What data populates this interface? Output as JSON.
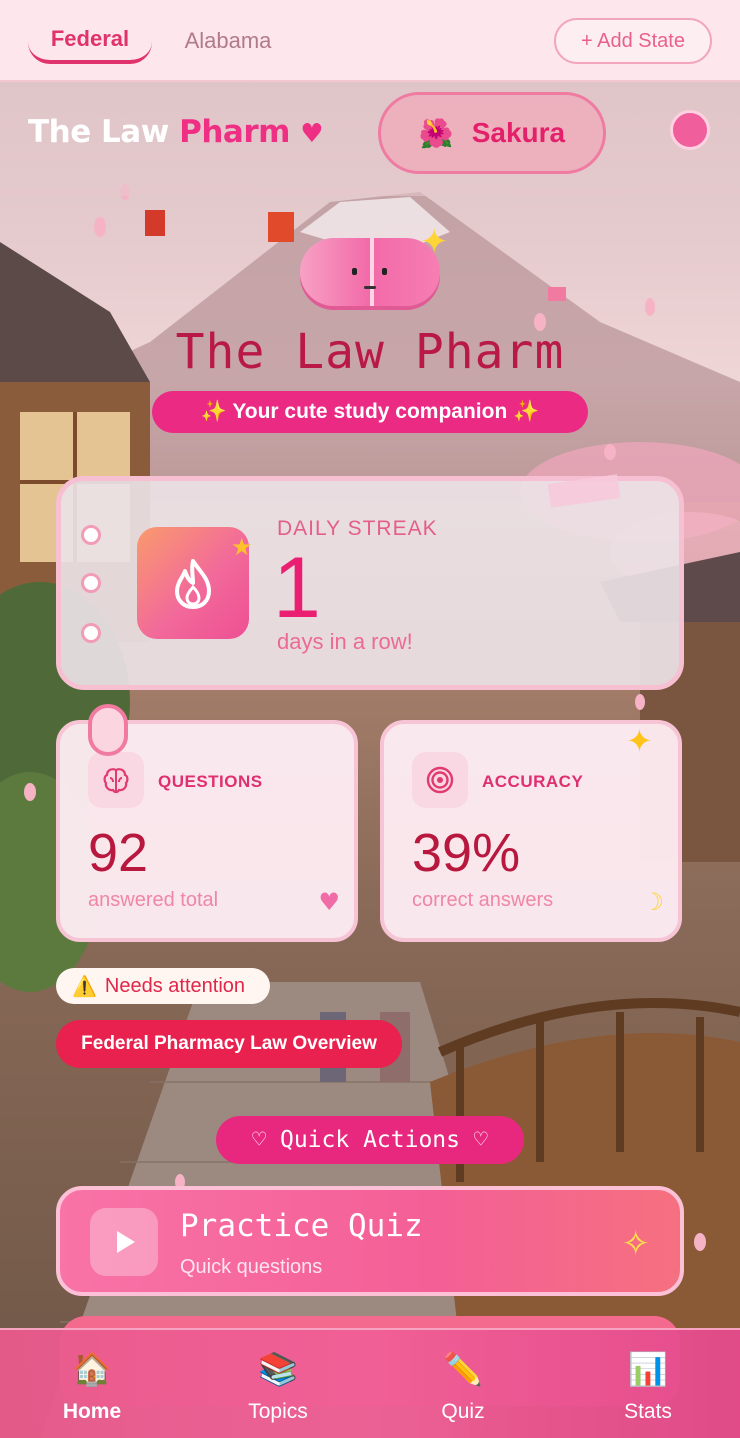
{
  "tabs": {
    "items": [
      {
        "label": "Federal",
        "active": true
      },
      {
        "label": "Alabama",
        "active": false
      }
    ],
    "add_state_label": "+ Add State"
  },
  "header": {
    "brand_white": "The Law ",
    "brand_pink": "Pharm",
    "brand_heart": "♥",
    "theme_label": "Sakura",
    "theme_icon": "hibiscus-icon"
  },
  "hero": {
    "title": "The Law Pharm",
    "subtitle": "✨ Your cute study companion ✨"
  },
  "streak": {
    "label": "DAILY STREAK",
    "value": "1",
    "caption": "days in a row!"
  },
  "stats": {
    "questions": {
      "label": "QUESTIONS",
      "value": "92",
      "caption": "answered total",
      "icon": "brain-icon"
    },
    "accuracy": {
      "label": "ACCURACY",
      "value": "39%",
      "caption": "correct answers",
      "icon": "target-icon"
    }
  },
  "attention": {
    "label": "Needs attention",
    "topic": "Federal Pharmacy Law Overview"
  },
  "quick_actions": {
    "label": "♡ Quick Actions ♡",
    "practice_title": "Practice Quiz",
    "practice_subtitle": "Quick questions"
  },
  "nav": {
    "items": [
      {
        "label": "Home",
        "icon": "house-icon",
        "active": true
      },
      {
        "label": "Topics",
        "icon": "books-icon",
        "active": false
      },
      {
        "label": "Quiz",
        "icon": "pencil-icon",
        "active": false
      },
      {
        "label": "Stats",
        "icon": "bar-chart-icon",
        "active": false
      }
    ]
  },
  "colors": {
    "accent": "#ea2a83",
    "brand_pink": "#ef2f83",
    "deep_rose": "#b8173e",
    "nav_bg": "#f05f96"
  }
}
